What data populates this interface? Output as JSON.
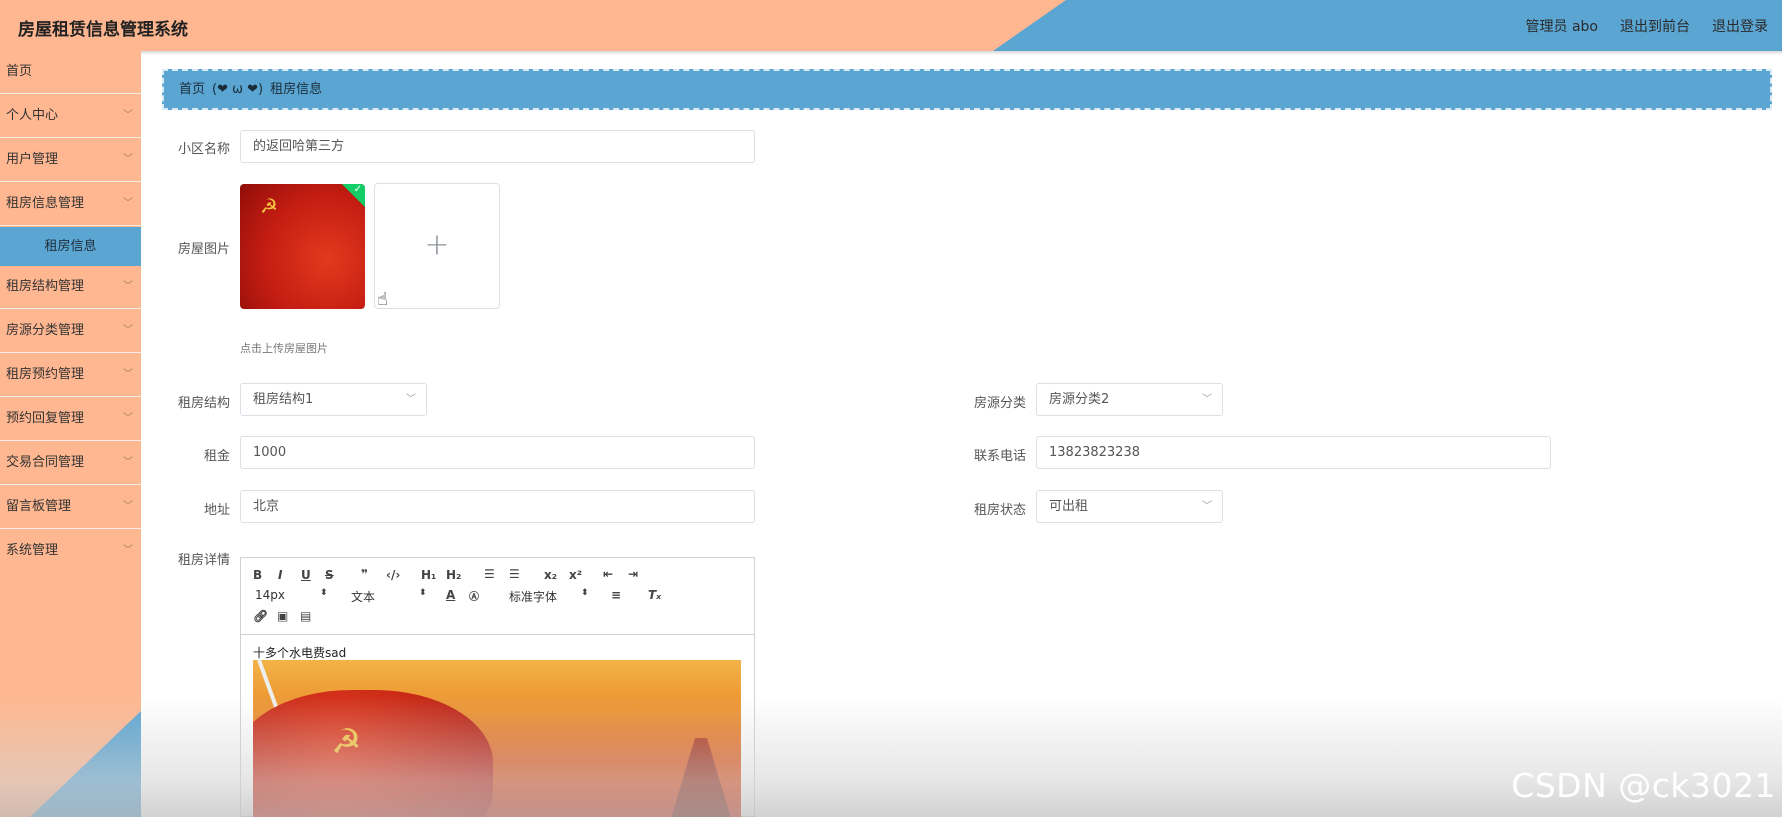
{
  "header": {
    "title": "房屋租赁信息管理系统",
    "admin": "管理员 abo",
    "to_front": "退出到前台",
    "logout": "退出登录"
  },
  "sidebar": {
    "items": [
      {
        "label": "首页",
        "has_chevron": false
      },
      {
        "label": "个人中心",
        "has_chevron": true
      },
      {
        "label": "用户管理",
        "has_chevron": true
      },
      {
        "label": "租房信息管理",
        "has_chevron": true
      },
      {
        "label": "租房结构管理",
        "has_chevron": true
      },
      {
        "label": "房源分类管理",
        "has_chevron": true
      },
      {
        "label": "租房预约管理",
        "has_chevron": true
      },
      {
        "label": "预约回复管理",
        "has_chevron": true
      },
      {
        "label": "交易合同管理",
        "has_chevron": true
      },
      {
        "label": "留言板管理",
        "has_chevron": true
      },
      {
        "label": "系统管理",
        "has_chevron": true
      }
    ],
    "active_sub": "租房信息"
  },
  "breadcrumb": {
    "home": "首页",
    "separator": "(❤ ω ❤)",
    "current": "租房信息"
  },
  "form": {
    "community_label": "小区名称",
    "community_value": "的返回哈第三方",
    "images_label": "房屋图片",
    "upload_hint": "点击上传房屋图片",
    "structure_label": "租房结构",
    "structure_value": "租房结构1",
    "category_label": "房源分类",
    "category_value": "房源分类2",
    "rent_label": "租金",
    "rent_value": "1000",
    "phone_label": "联系电话",
    "phone_value": "13823823238",
    "address_label": "地址",
    "address_value": "北京",
    "status_label": "租房状态",
    "status_value": "可出租",
    "detail_label": "租房详情"
  },
  "editor": {
    "font_size": "14px",
    "text_type": "文本",
    "font_family": "标准字体",
    "content": "十多个水电费sad"
  },
  "watermark": "CSDN @ck3021",
  "colors": {
    "peach": "#ffb791",
    "blue": "#5ba5d2"
  }
}
